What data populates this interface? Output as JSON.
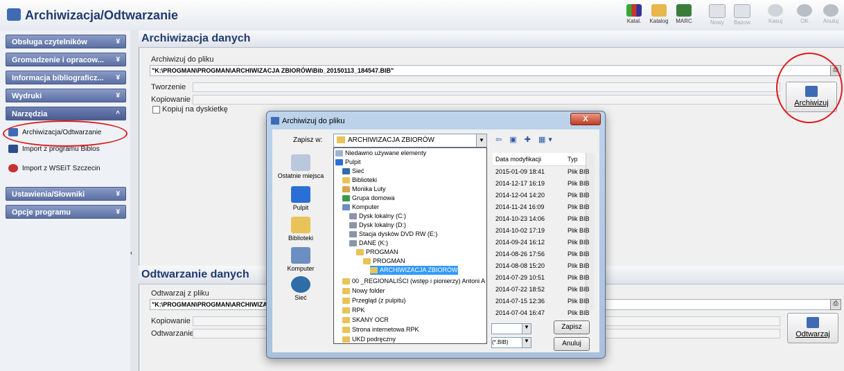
{
  "app": {
    "title": "Archiwizacja/Odtwarzanie"
  },
  "toolbar": [
    {
      "label": "Katal."
    },
    {
      "label": "Katalog"
    },
    {
      "label": "MARC"
    },
    {
      "label": "Nowy"
    },
    {
      "label": "Bazow"
    },
    {
      "label": "Kasuj"
    },
    {
      "label": "OK"
    },
    {
      "label": "Anuluj"
    }
  ],
  "sidebar": {
    "groups": [
      {
        "label": "Obsługa czytelników"
      },
      {
        "label": "Gromadzenie i opracow..."
      },
      {
        "label": "Informacja bibliograficz..."
      },
      {
        "label": "Wydruki"
      },
      {
        "label": "Narzędzia"
      },
      {
        "label": "Ustawienia/Słowniki"
      },
      {
        "label": "Opcje programu"
      }
    ],
    "tools": [
      {
        "label": "Archiwizacja/Odtwarzanie"
      },
      {
        "label": "Import z programu Biblos"
      },
      {
        "label": "Import z WSEiT Szczecin"
      }
    ]
  },
  "archive": {
    "heading": "Archiwizacja danych",
    "file_label": "Archiwizuj do pliku",
    "file_value": "\"K:\\PROGMAN\\PROGMAN\\ARCHIWIZACJA ZBIORÓW\\Bib_20150113_184547.BIB\"",
    "create_label": "Tworzenie",
    "copy_label": "Kopiowanie",
    "floppy_label": "Kopiuj na dyskietkę",
    "button": "Archiwizuj"
  },
  "restore": {
    "heading": "Odtwarzanie danych",
    "file_label": "Odtwarzaj z pliku",
    "file_value": "\"K:\\PROGMAN\\PROGMAN\\ARCHIWIZA",
    "copy_label": "Kopiowanie",
    "restore_label": "Odtwarzanie",
    "button": "Odtwarzaj"
  },
  "dialog": {
    "title": "Archiwizuj do pliku",
    "close": "X",
    "save_in_label": "Zapisz w:",
    "folder": "ARCHIWIZACJA ZBIORÓW",
    "places": [
      {
        "label": "Ostatnie miejsca"
      },
      {
        "label": "Pulpit"
      },
      {
        "label": "Biblioteki"
      },
      {
        "label": "Komputer"
      },
      {
        "label": "Sieć"
      }
    ],
    "dropdown": [
      {
        "label": "Niedawno używane elementy"
      },
      {
        "label": "Pulpit"
      },
      {
        "label": "Sieć"
      },
      {
        "label": "Biblioteki"
      },
      {
        "label": "Monika Luty"
      },
      {
        "label": "Grupa domowa"
      },
      {
        "label": "Komputer"
      },
      {
        "label": "Dysk lokalny (C:)"
      },
      {
        "label": "Dysk lokalny (D:)"
      },
      {
        "label": "Stacja dysków DVD RW (E:)"
      },
      {
        "label": "DANE (K:)"
      },
      {
        "label": "PROGMAN"
      },
      {
        "label": "PROGMAN"
      },
      {
        "label": "ARCHIWIZACJA ZBIORÓW"
      },
      {
        "label": "00 _REGIONALIŚCI  (wstęp i pionierzy) Antoni A"
      },
      {
        "label": "Nowy folder"
      },
      {
        "label": "Przegląd (z pulpitu)"
      },
      {
        "label": "RPK"
      },
      {
        "label": "SKANY OCR"
      },
      {
        "label": "Strona internetowa RPK"
      },
      {
        "label": "UKD podręczny"
      }
    ],
    "columns": {
      "date": "Data modyfikacji",
      "type": "Typ"
    },
    "files": [
      {
        "date": "2015-01-09 18:41",
        "type": "Plik BIB"
      },
      {
        "date": "2014-12-17 16:19",
        "type": "Plik BIB"
      },
      {
        "date": "2014-12-04 14:20",
        "type": "Plik BIB"
      },
      {
        "date": "2014-11-24 16:09",
        "type": "Plik BIB"
      },
      {
        "date": "2014-10-23 14:06",
        "type": "Plik BIB"
      },
      {
        "date": "2014-10-02 17:19",
        "type": "Plik BIB"
      },
      {
        "date": "2014-09-24 16:12",
        "type": "Plik BIB"
      },
      {
        "date": "2014-08-26 17:56",
        "type": "Plik BIB"
      },
      {
        "date": "2014-08-08 15:20",
        "type": "Plik BIB"
      },
      {
        "date": "2014-07-29 10:51",
        "type": "Plik BIB"
      },
      {
        "date": "2014-07-22 18:52",
        "type": "Plik BIB"
      },
      {
        "date": "2014-07-15 12:36",
        "type": "Plik BIB"
      },
      {
        "date": "2014-07-04 16:47",
        "type": "Plik BIB"
      }
    ],
    "save_button": "Zapisz",
    "cancel_button": "Anuluj",
    "file_type": "(*.BIB)"
  }
}
